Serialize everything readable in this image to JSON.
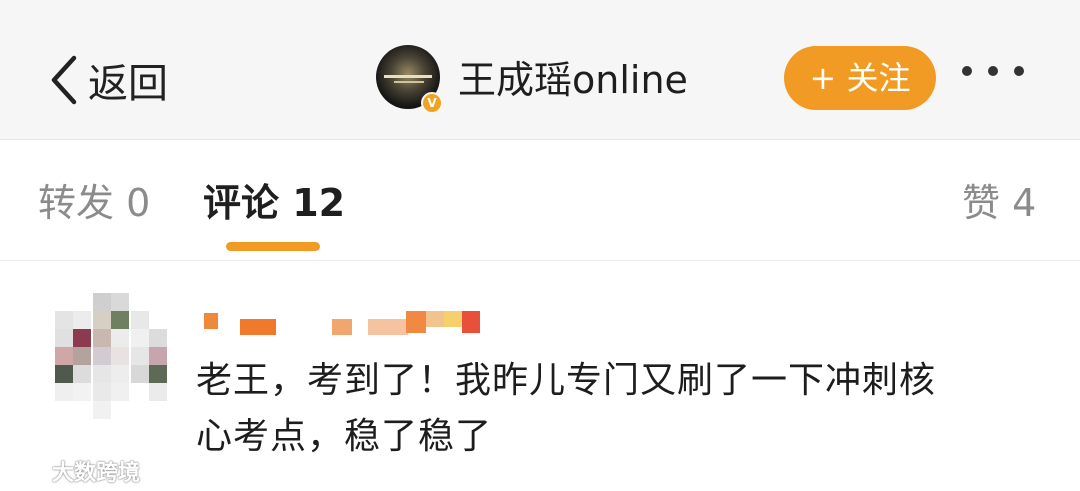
{
  "header": {
    "back_label": "返回",
    "username": "王成瑶online",
    "follow_label": "+ 关注",
    "verified_badge": "V"
  },
  "tabs": {
    "repost": "转发 0",
    "comments": "评论 12",
    "likes": "赞 4"
  },
  "comment": {
    "text_line1": "老王，考到了！我昨儿专门又刷了一下冲刺核",
    "text_line2": "心考点，稳了稳了"
  },
  "watermark": {
    "text": "大数跨境"
  },
  "colors": {
    "accent": "#f29b24",
    "topbar_bg": "#f6f6f6"
  }
}
